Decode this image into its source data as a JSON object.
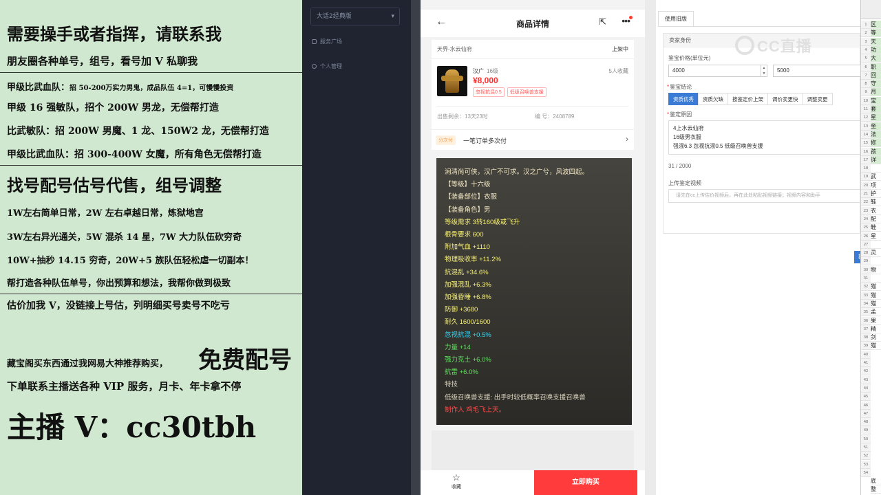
{
  "overlay": {
    "lines": [
      "需要操手或者指挥，请联系我",
      "朋友圈各种单号，组号，看号加 V 私聊我",
      "甲级比武血队：",
      "招 50-200万实力男鬼，成品队伍 4=1，可慢慢投资",
      "甲级 16 强敏队，招个 200W 男龙，无偿帮打造",
      "比武敏队：招 200W 男魔、1 龙、150W2 龙，无偿帮打造",
      "甲级比武血队：招 300-400W 女魔，所有角色无偿帮打造",
      "找号配号估号代售，组号调整",
      "1W左右简单日常，2W 左右卓越日常，炼狱地宫",
      "3W左右异光通关，5W 混杀 14 星，7W 大力队伍砍穷奇",
      "10W+抽秒 14.15 穷奇，20W+5 族队伍轻松虐一切副本！",
      "帮打造各种队伍单号，你出预算和想法，我帮你做到极致",
      "估价加我 V，没链接上号估，列明细买号卖号不吃亏",
      "藏宝阁买东西通过我网易大神推荐购买，",
      "免费配号",
      "下单联系主播送各种 VIP 服务，月卡、年卡拿不停",
      "主播 V：cc30tbh"
    ]
  },
  "sidebar": {
    "select_value": "大话2经典版",
    "items": [
      "服务广场",
      "个人管理"
    ]
  },
  "phone": {
    "title": "商品详情",
    "server": "天界-水云仙府",
    "shelf_status": "上架中",
    "item_name": "汉广",
    "item_level": "16级",
    "favorites": "5人收藏",
    "price": "¥8,000",
    "tags": [
      "忽视抗混0.5",
      "低级召唤兽支援"
    ],
    "remaining": "出售剩余：13天23时",
    "serial": "编 号：2408789",
    "installment_badge": "分次付",
    "installment_text": "一笔订单多次付",
    "attrs": [
      {
        "text": "涧清尚可侠，汉广不可求。汉之广兮，风波四起。",
        "color": "#f3e9c6"
      },
      {
        "text": "【等级】十六级",
        "color": "#f3e9c6"
      },
      {
        "text": "【装备部位】衣服",
        "color": "#f3e9c6"
      },
      {
        "text": "【装备角色】男",
        "color": "#f3e9c6"
      },
      {
        "text": "等级需求 3转160级或飞升",
        "color": "#f5ef7a"
      },
      {
        "text": "根骨要求 600",
        "color": "#f5ef7a"
      },
      {
        "text": "附加气血 +1110",
        "color": "#f5ef7a"
      },
      {
        "text": "物理吸收率 +11.2%",
        "color": "#f5ef7a"
      },
      {
        "text": "抗混乱 +34.6%",
        "color": "#f5ef7a"
      },
      {
        "text": "加强混乱 +6.3%",
        "color": "#f5ef7a"
      },
      {
        "text": "加强昏睡 +6.8%",
        "color": "#f5ef7a"
      },
      {
        "text": "防御 +3680",
        "color": "#f5ef7a"
      },
      {
        "text": "耐久 1600/1600",
        "color": "#f5ef7a"
      },
      {
        "text": "忽视抗混 +0.5%",
        "color": "#35d4f0"
      },
      {
        "text": "力量 +14",
        "color": "#5ee05e"
      },
      {
        "text": "强力克土 +6.0%",
        "color": "#5ee05e"
      },
      {
        "text": "抗雷 +6.0%",
        "color": "#5ee05e"
      },
      {
        "text": "特技",
        "color": "#d9d2bd"
      },
      {
        "text": "低级召唤兽支援: 出手时较低概率召唤支援召唤兽",
        "color": "#d9d2bd"
      },
      {
        "text": "制作人 鸡毛飞上天。",
        "color": "#ff4a4a"
      }
    ],
    "favorite_label": "收藏",
    "buy_label": "立即购买"
  },
  "form": {
    "tab_label": "使用旧版",
    "section_title": "卖家身份",
    "price_label": "鉴宝价格(单位元)",
    "price_min": "4000",
    "price_max": "5000",
    "conclusion_label": "鉴宝结论",
    "conclusion_options": [
      "资质优秀",
      "资质欠缺",
      "按鉴定价上架",
      "调价卖更快",
      "调整卖更"
    ],
    "reason_label": "鉴定原因",
    "reason_lines": [
      "4上水云仙府",
      "16级男衣服",
      "强混6.3 忽视抗混0.5 低级召唤兽支援"
    ],
    "char_count": "31 / 2000",
    "video_label": "上传鉴定视频",
    "video_placeholder": "请先在cc上传估价视频后，再在此处粘贴视频链接；视频内容和助手",
    "submit_label": "提",
    "watermark": "CC直播"
  },
  "sheet": {
    "cells": [
      "区",
      "等",
      "天",
      "功",
      "大",
      "职",
      "回",
      "守",
      "月",
      "宝",
      "套",
      "星",
      "坐",
      "法",
      "修",
      "孩",
      "详",
      "",
      "武",
      "项",
      "护",
      "鞋",
      "衣",
      "配",
      "鞋",
      "星",
      "",
      "灵",
      "",
      "物",
      "",
      "猫",
      "猫",
      "猫",
      "孟",
      "果",
      "精",
      "剑",
      "猫"
    ],
    "row_numbers": [
      "1",
      "2",
      "3",
      "4",
      "5",
      "6",
      "7",
      "8",
      "9",
      "10",
      "11",
      "12",
      "13",
      "14",
      "15",
      "16",
      "17",
      "18",
      "19",
      "20",
      "21",
      "22",
      "23",
      "24",
      "25",
      "26",
      "27",
      "28",
      "29",
      "30",
      "31",
      "32",
      "33",
      "34",
      "35",
      "36",
      "37",
      "38",
      "39",
      "40",
      "41",
      "42",
      "43",
      "44",
      "45",
      "46",
      "47",
      "48",
      "49",
      "50",
      "51",
      "52",
      "53",
      "54"
    ],
    "bottom_cells": [
      "底",
      "整"
    ]
  }
}
